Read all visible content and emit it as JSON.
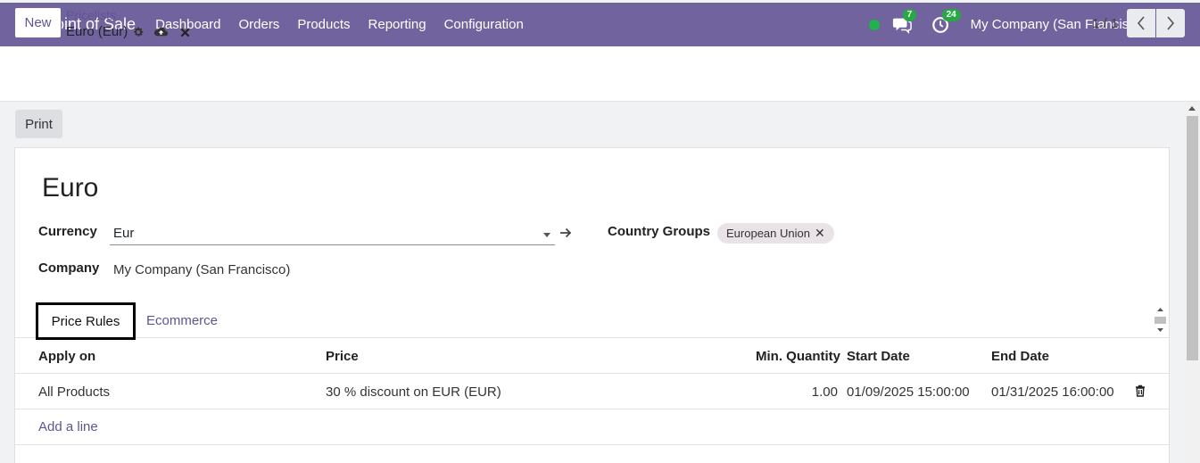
{
  "navbar": {
    "app_name": "Point of Sale",
    "menu": [
      "Dashboard",
      "Orders",
      "Products",
      "Reporting",
      "Configuration"
    ],
    "messages_count": "7",
    "activities_count": "24",
    "company": "My Company (San Francisco)",
    "status_color": "#21b24b",
    "accent_color": "#71639e"
  },
  "control": {
    "new_label": "New",
    "breadcrumb_parent": "Pricelists",
    "breadcrumb_current": "Euro (Eur)",
    "pager": "1 / 1",
    "print_label": "Print"
  },
  "record": {
    "name": "Euro",
    "currency_label": "Currency",
    "currency_value": "Eur",
    "company_label": "Company",
    "company_value": "My Company (San Francisco)",
    "country_groups_label": "Country Groups",
    "country_group_tag": "European Union"
  },
  "tabs": {
    "active": "Price Rules",
    "other": "Ecommerce"
  },
  "table": {
    "headers": [
      "Apply on",
      "Price",
      "Min. Quantity",
      "Start Date",
      "End Date"
    ],
    "rows": [
      [
        "All Products",
        "30 % discount on EUR (EUR)",
        "1.00",
        "01/09/2025 15:00:00",
        "01/31/2025 16:00:00"
      ]
    ],
    "add_line": "Add a line"
  }
}
